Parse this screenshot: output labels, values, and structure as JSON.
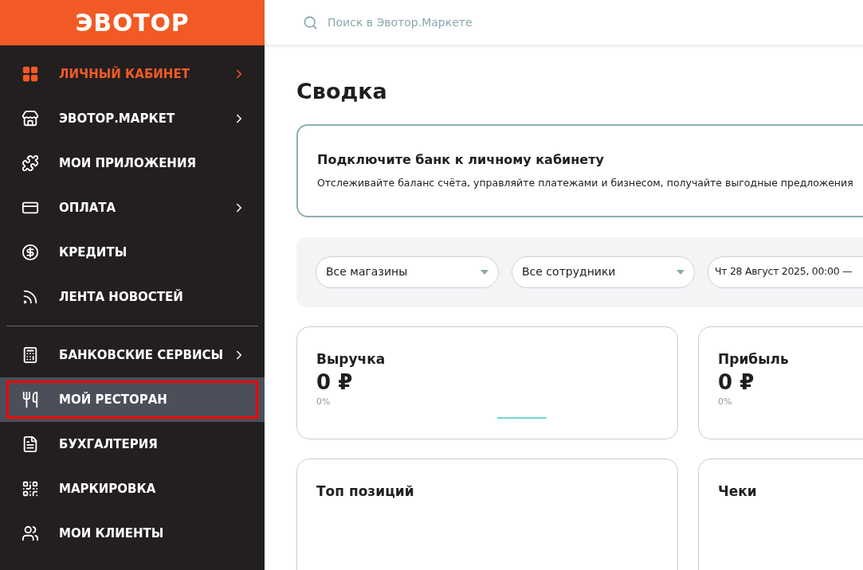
{
  "logo": "ЭВОТОР",
  "sidebar": {
    "items": [
      {
        "label": "ЛИЧНЫЙ КАБИНЕТ",
        "active": true,
        "selected": false,
        "outlined": false,
        "has_submenu": true
      },
      {
        "label": "ЭВОТОР.МАРКЕТ",
        "active": false,
        "selected": false,
        "outlined": false,
        "has_submenu": true
      },
      {
        "label": "МОИ ПРИЛОЖЕНИЯ",
        "active": false,
        "selected": false,
        "outlined": false,
        "has_submenu": false
      },
      {
        "label": "ОПЛАТА",
        "active": false,
        "selected": false,
        "outlined": false,
        "has_submenu": true
      },
      {
        "label": "КРЕДИТЫ",
        "active": false,
        "selected": false,
        "outlined": false,
        "has_submenu": false
      },
      {
        "label": "ЛЕНТА НОВОСТЕЙ",
        "active": false,
        "selected": false,
        "outlined": false,
        "has_submenu": false
      }
    ],
    "items_2": [
      {
        "label": "БАНКОВСКИЕ СЕРВИСЫ",
        "active": false,
        "selected": false,
        "outlined": false,
        "has_submenu": true
      },
      {
        "label": "МОЙ РЕСТОРАН",
        "active": false,
        "selected": true,
        "outlined": true,
        "has_submenu": false
      },
      {
        "label": "БУХГАЛТЕРИЯ",
        "active": false,
        "selected": false,
        "outlined": false,
        "has_submenu": false
      },
      {
        "label": "МАРКИРОВКА",
        "active": false,
        "selected": false,
        "outlined": false,
        "has_submenu": false
      },
      {
        "label": "МОИ КЛИЕНТЫ",
        "active": false,
        "selected": false,
        "outlined": false,
        "has_submenu": false
      }
    ]
  },
  "search": {
    "placeholder": "Поиск в Эвотор.Маркете"
  },
  "title": "Сводка",
  "banner": {
    "title": "Подключите банк к личному кабинету",
    "text": "Отслеживайте баланс счёта, управляйте платежами и бизнесом, получайте выгодные предложения"
  },
  "filters": [
    {
      "value": "Все магазины",
      "kind": "dropdown"
    },
    {
      "value": "Все сотрудники",
      "kind": "dropdown"
    },
    {
      "value": "Чт 28 Август 2025, 00:00 —",
      "kind": "date"
    }
  ],
  "metrics": [
    {
      "title": "Выручка",
      "value": "0 ₽",
      "change": "0%"
    },
    {
      "title": "Прибыль",
      "value": "0 ₽",
      "change": "0%"
    }
  ],
  "panels": [
    {
      "title": "Топ позиций"
    },
    {
      "title": "Чеки"
    }
  ]
}
